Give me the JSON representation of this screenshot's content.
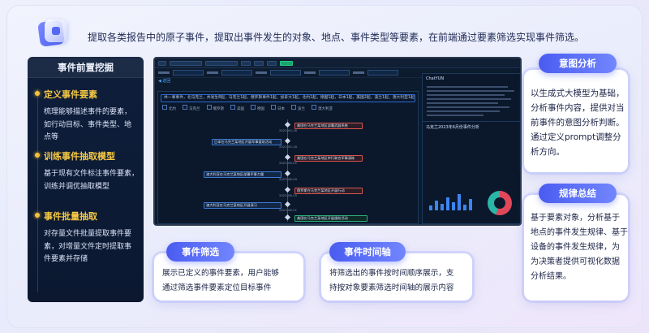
{
  "header": {
    "logo_icon": "stacked-cards-logo",
    "description": "提取各类报告中的原子事件，提取出事件发生的对象、地点、事件类型等要素，在前端通过要素筛选实现事件筛选。"
  },
  "sidebar": {
    "title": "事件前置挖掘",
    "sections": [
      {
        "heading": "定义事件要素",
        "lines": [
          "梳理能够描述事件的要素，",
          "如行动目标、事件类型、地",
          "点等"
        ]
      },
      {
        "heading": "训练事件抽取模型",
        "lines": [
          "基于现有文件标注事件要素，",
          "训练并调优抽取模型"
        ]
      },
      {
        "heading": "事件批量抽取",
        "lines": [
          "对存量文件批量提取事件要",
          "素，对增量文件定时提取事",
          "件要素并存储"
        ]
      }
    ]
  },
  "app_screenshot": {
    "sub_link": "◀ 返回",
    "tagline": "共一事事件，北马克兰，共发生8起，马克兰1起，俄罗斯事件1起，加拿大1起，北约1起，德国1起，日本1起，美国2起，波兰1起，澳大利亚1起，俄罗斯2起，英国1起",
    "legend": [
      "北约",
      "马克兰",
      "俄罗斯",
      "美国",
      "德国",
      "日本",
      "波兰",
      "澳大利亚"
    ],
    "events": [
      {
        "text": "美国在马克兰某地区部署武器系统",
        "color": "red"
      },
      {
        "text": "日本在马克兰某地区开展军事援助活动",
        "color": "blue"
      },
      {
        "text": "美国在马克兰某地区举行联合军事演练",
        "color": "red"
      },
      {
        "text": "澳大利亚在马克兰某地区部署军事力量",
        "color": "blue"
      },
      {
        "text": "俄罗斯在马克兰某地区开展行动",
        "color": "red"
      },
      {
        "text": "澳大利亚在马克兰某地区开展演习",
        "color": "blue"
      },
      {
        "text": "美国在马克兰某地区开展援助活动",
        "color": "green"
      }
    ],
    "dates": [
      "2023-05-16",
      "2023-05-18",
      "2023-06-02",
      "2023-06-09",
      "2023-06-15",
      "2023-06-21",
      "2023-06-28"
    ],
    "right_panel_title": "ChatYUN",
    "chart_title": "马克兰2023年6月份事件分析"
  },
  "callouts": {
    "intent": {
      "title": "意图分析",
      "lines": [
        "以生成式大模型为基础，",
        "分析事件内容，提供对当",
        "前事件的意图分析判断。",
        "通过定义prompt调整分",
        "析方向。"
      ]
    },
    "rules": {
      "title": "规律总结",
      "lines": [
        "基于要素对象，分析基于",
        "地点的事件发生规律、基于",
        "设备的事件发生规律，为",
        "为决策者提供可视化数据",
        "分析结果。"
      ]
    },
    "filter": {
      "title": "事件筛选",
      "lines": [
        "展示已定义的事件要素，用户能够",
        "通过筛选事件要素定位目标事件"
      ]
    },
    "timeline": {
      "title": "事件时间轴",
      "lines": [
        "将筛选出的事件按时间顺序展示，支",
        "持按对象要素筛选时间轴的展示内容"
      ]
    }
  }
}
